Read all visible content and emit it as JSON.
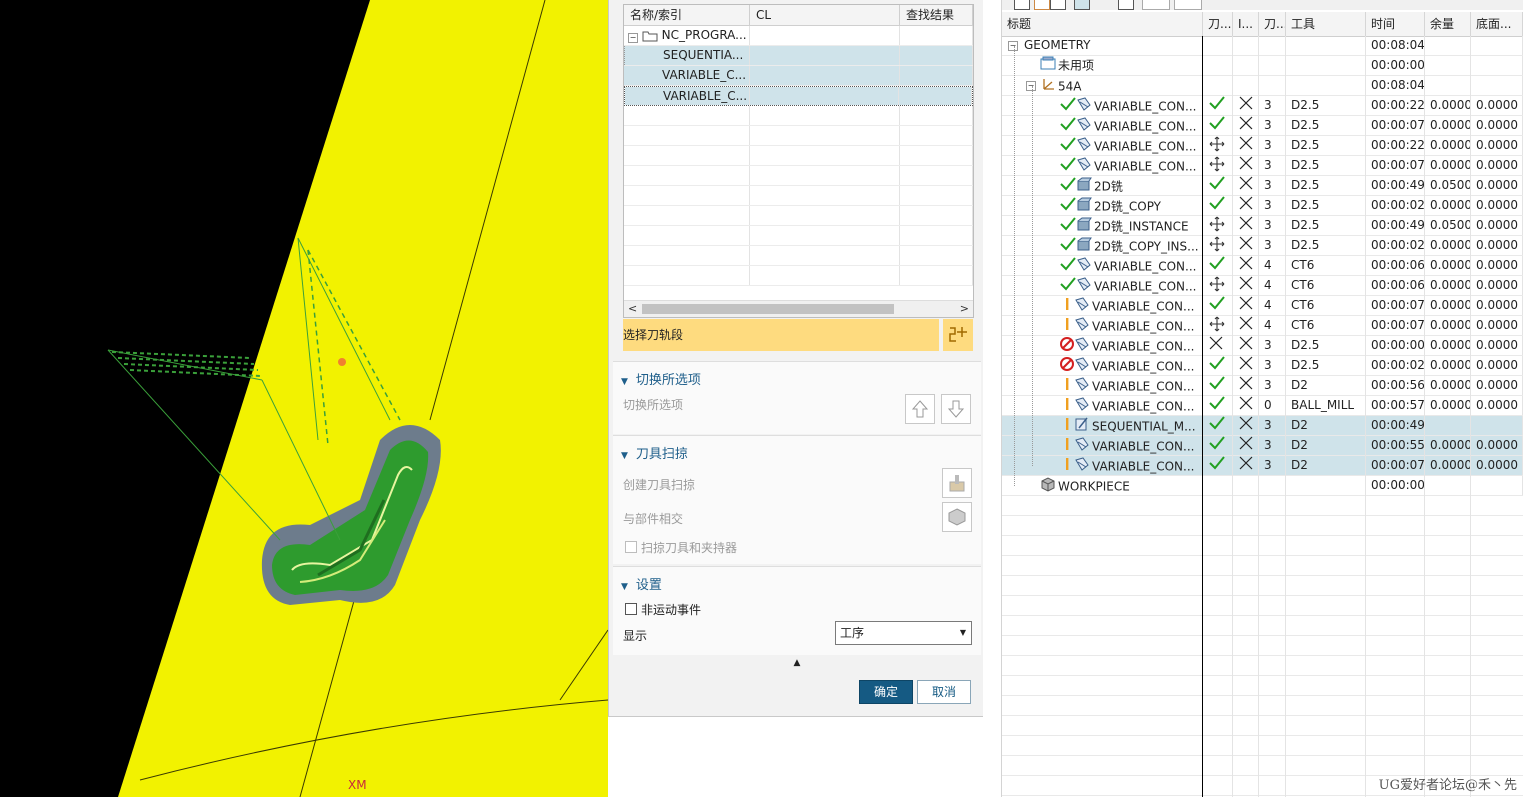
{
  "viewport": {
    "axis_label": "XM"
  },
  "dialog": {
    "table": {
      "headers": [
        "名称/索引",
        "CL",
        "查找结果"
      ],
      "root": "NC_PROGRA...",
      "items": [
        "SEQUENTIA...",
        "VARIABLE_C...",
        "VARIABLE_C..."
      ]
    },
    "select_toolpath": "选择刀轨段",
    "switch_section": {
      "title": "切换所选项",
      "label": "切换所选项"
    },
    "sweep_section": {
      "title": "刀具扫掠",
      "create_label": "创建刀具扫掠",
      "intersect_label": "与部件相交",
      "checkbox_label": "扫掠刀具和夹持器"
    },
    "settings_section": {
      "title": "设置",
      "nonmotion_label": "非运动事件",
      "display_label": "显示",
      "display_value": "工序"
    },
    "ok": "确定",
    "cancel": "取消"
  },
  "navigator": {
    "headers": [
      "标题",
      "刀...",
      "I...",
      "刀...",
      "工具",
      "时间",
      "余量",
      "底面..."
    ],
    "rows": [
      {
        "level": 0,
        "icon": "geometry",
        "name": "GEOMETRY",
        "time": "00:08:04"
      },
      {
        "level": 1,
        "icon": "folder",
        "name": "未用项",
        "time": "00:00:00"
      },
      {
        "level": 1,
        "icon": "mcs",
        "name": "54A",
        "time": "00:08:04"
      },
      {
        "level": 2,
        "status": "check",
        "icon": "op-contour",
        "name": "VARIABLE_CON...",
        "path": "check",
        "ipw": "cross",
        "no": "3",
        "tool": "D2.5",
        "time": "00:00:22",
        "stock": "0.0000",
        "floor": "0.0000"
      },
      {
        "level": 2,
        "status": "check",
        "icon": "op-contour",
        "name": "VARIABLE_CON...",
        "path": "check",
        "ipw": "cross",
        "no": "3",
        "tool": "D2.5",
        "time": "00:00:07",
        "stock": "0.0000",
        "floor": "0.0000"
      },
      {
        "level": 2,
        "status": "check",
        "icon": "op-contour",
        "name": "VARIABLE_CON...",
        "path": "move",
        "ipw": "cross",
        "no": "3",
        "tool": "D2.5",
        "time": "00:00:22",
        "stock": "0.0000",
        "floor": "0.0000"
      },
      {
        "level": 2,
        "status": "check",
        "icon": "op-contour",
        "name": "VARIABLE_CON...",
        "path": "move",
        "ipw": "cross",
        "no": "3",
        "tool": "D2.5",
        "time": "00:00:07",
        "stock": "0.0000",
        "floor": "0.0000"
      },
      {
        "level": 2,
        "status": "check",
        "icon": "op-2d",
        "name": "2D铣",
        "path": "check",
        "ipw": "cross",
        "no": "3",
        "tool": "D2.5",
        "time": "00:00:49",
        "stock": "0.0500",
        "floor": "0.0000"
      },
      {
        "level": 2,
        "status": "check",
        "icon": "op-2d",
        "name": "2D铣_COPY",
        "path": "check",
        "ipw": "cross",
        "no": "3",
        "tool": "D2.5",
        "time": "00:00:02",
        "stock": "0.0000",
        "floor": "0.0000"
      },
      {
        "level": 2,
        "status": "check",
        "icon": "op-2d",
        "name": "2D铣_INSTANCE",
        "path": "move",
        "ipw": "cross",
        "no": "3",
        "tool": "D2.5",
        "time": "00:00:49",
        "stock": "0.0500",
        "floor": "0.0000"
      },
      {
        "level": 2,
        "status": "check",
        "icon": "op-2d",
        "name": "2D铣_COPY_INS...",
        "path": "move",
        "ipw": "cross",
        "no": "3",
        "tool": "D2.5",
        "time": "00:00:02",
        "stock": "0.0000",
        "floor": "0.0000"
      },
      {
        "level": 2,
        "status": "check",
        "icon": "op-contour",
        "name": "VARIABLE_CON...",
        "path": "check",
        "ipw": "cross",
        "no": "4",
        "tool": "CT6",
        "time": "00:00:06",
        "stock": "0.0000",
        "floor": "0.0000"
      },
      {
        "level": 2,
        "status": "check",
        "icon": "op-contour",
        "name": "VARIABLE_CON...",
        "path": "move",
        "ipw": "cross",
        "no": "4",
        "tool": "CT6",
        "time": "00:00:06",
        "stock": "0.0000",
        "floor": "0.0000"
      },
      {
        "level": 2,
        "status": "warn",
        "icon": "op-contour",
        "name": "VARIABLE_CON...",
        "path": "check",
        "ipw": "cross",
        "no": "4",
        "tool": "CT6",
        "time": "00:00:07",
        "stock": "0.0000",
        "floor": "0.0000"
      },
      {
        "level": 2,
        "status": "warn",
        "icon": "op-contour",
        "name": "VARIABLE_CON...",
        "path": "move",
        "ipw": "cross",
        "no": "4",
        "tool": "CT6",
        "time": "00:00:07",
        "stock": "0.0000",
        "floor": "0.0000"
      },
      {
        "level": 2,
        "status": "stop",
        "icon": "op-contour",
        "name": "VARIABLE_CON...",
        "path": "cross",
        "ipw": "cross",
        "no": "3",
        "tool": "D2.5",
        "time": "00:00:00",
        "stock": "0.0000",
        "floor": "0.0000"
      },
      {
        "level": 2,
        "status": "stop",
        "icon": "op-contour",
        "name": "VARIABLE_CON...",
        "path": "check",
        "ipw": "cross",
        "no": "3",
        "tool": "D2.5",
        "time": "00:00:02",
        "stock": "0.0000",
        "floor": "0.0000"
      },
      {
        "level": 2,
        "status": "warn",
        "icon": "op-contour",
        "name": "VARIABLE_CON...",
        "path": "check",
        "ipw": "cross",
        "no": "3",
        "tool": "D2",
        "time": "00:00:56",
        "stock": "0.0000",
        "floor": "0.0000"
      },
      {
        "level": 2,
        "status": "warn",
        "icon": "op-contour",
        "name": "VARIABLE_CON...",
        "path": "check",
        "ipw": "cross",
        "no": "0",
        "tool": "BALL_MILL",
        "time": "00:00:57",
        "stock": "0.0000",
        "floor": "0.0000"
      },
      {
        "level": 2,
        "status": "warn",
        "icon": "op-seq",
        "name": "SEQUENTIAL_M...",
        "path": "check",
        "ipw": "cross",
        "no": "3",
        "tool": "D2",
        "time": "00:00:49",
        "stock": "",
        "floor": "",
        "selected": true
      },
      {
        "level": 2,
        "status": "warn",
        "icon": "op-contour",
        "name": "VARIABLE_CON...",
        "path": "check",
        "ipw": "cross",
        "no": "3",
        "tool": "D2",
        "time": "00:00:55",
        "stock": "0.0000",
        "floor": "0.0000",
        "selected": true
      },
      {
        "level": 2,
        "status": "warn",
        "icon": "op-contour",
        "name": "VARIABLE_CON...",
        "path": "check",
        "ipw": "cross",
        "no": "3",
        "tool": "D2",
        "time": "00:00:07",
        "stock": "0.0000",
        "floor": "0.0000",
        "selected": true
      },
      {
        "level": 1,
        "icon": "workpiece",
        "name": "WORKPIECE",
        "time": "00:00:00"
      }
    ]
  },
  "watermark": "UG爱好者论坛@禾丶先",
  "colors": {
    "selection": "#cfe3ea",
    "highlight": "#fedb7f",
    "accent": "#155a83",
    "part": "#f2f200",
    "toolpath": "#2f9a2f"
  }
}
